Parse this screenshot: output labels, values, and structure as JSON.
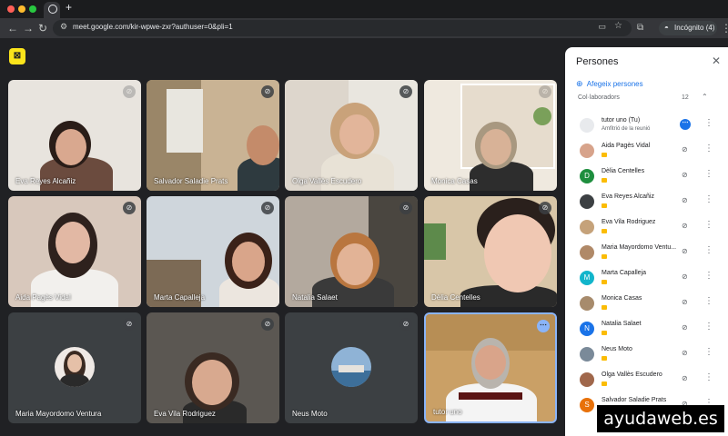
{
  "browser": {
    "url": "meet.google.com/kir-wpwe-zxr?authuser=0&pli=1",
    "incognito_label": "Incógnito (4)",
    "new_tab_label": "+"
  },
  "meet": {
    "captions_icon": "captions-off-icon",
    "tiles": [
      {
        "name": "Eva Reyes Alcañiz",
        "mic": "muted"
      },
      {
        "name": "Salvador Saladie Prats",
        "mic": "muted"
      },
      {
        "name": "Olga Vallès Escudero",
        "mic": "muted"
      },
      {
        "name": "Monica Casas",
        "mic": "muted"
      },
      {
        "name": "Aida Pagès Vidal",
        "mic": "muted"
      },
      {
        "name": "Marta Capalleja",
        "mic": "muted"
      },
      {
        "name": "Natalia Salaet",
        "mic": "muted"
      },
      {
        "name": "Dèlia Centelles",
        "mic": "muted"
      },
      {
        "name": "Maria Mayordomo Ventura",
        "mic": "muted"
      },
      {
        "name": "Eva Vila Rodriguez",
        "mic": "muted"
      },
      {
        "name": "Neus Moto",
        "mic": "muted"
      },
      {
        "name": "tutor uno",
        "mic": "more"
      }
    ]
  },
  "people_panel": {
    "title": "Persones",
    "add_label": "Afegeix persones",
    "section_label": "Col·laboradors",
    "section_count": "12",
    "participants": [
      {
        "name": "tutor uno (Tu)",
        "sub": "Amfitrió de la reunió",
        "initial": "",
        "color": "#e8eaed",
        "self": true
      },
      {
        "name": "Aida Pagès Vidal",
        "initial": "",
        "color": "#d7a38b"
      },
      {
        "name": "Dèlia Centelles",
        "initial": "D",
        "color": "#1e8e3e"
      },
      {
        "name": "Eva Reyes Alcañiz",
        "initial": "",
        "color": "#3c4043"
      },
      {
        "name": "Eva Vila Rodriguez",
        "initial": "",
        "color": "#c5a27a"
      },
      {
        "name": "Maria Mayordomo Ventu...",
        "initial": "",
        "color": "#b08968"
      },
      {
        "name": "Marta Capalleja",
        "initial": "M",
        "color": "#12b5cb"
      },
      {
        "name": "Monica Casas",
        "initial": "",
        "color": "#a78b6c"
      },
      {
        "name": "Natalia Salaet",
        "initial": "N",
        "color": "#1a73e8"
      },
      {
        "name": "Neus Moto",
        "initial": "",
        "color": "#7a8a99"
      },
      {
        "name": "Olga Vallès Escudero",
        "initial": "",
        "color": "#a0674b"
      },
      {
        "name": "Salvador Saladie Prats",
        "initial": "S",
        "color": "#e8710a"
      }
    ]
  },
  "watermark": "ayudaweb.es"
}
